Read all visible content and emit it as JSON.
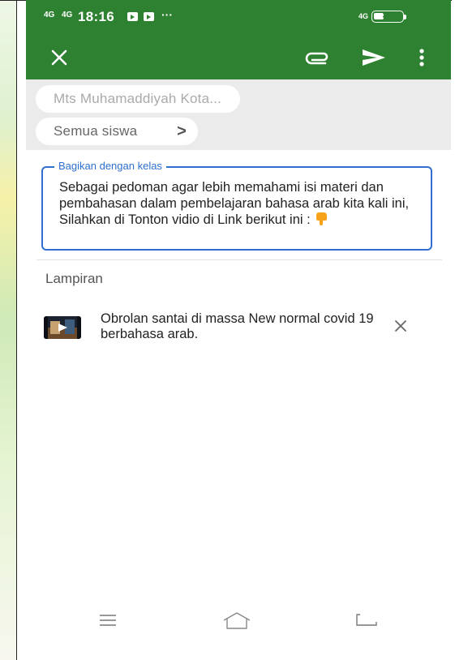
{
  "status_bar": {
    "network1": "4G",
    "network2": "4G",
    "time": "18:16",
    "more": "···",
    "network3": "4G",
    "battery": "37"
  },
  "app_bar": {
    "close_icon": "close-icon",
    "attach_icon": "attach-icon",
    "send_icon": "send-icon",
    "more_icon": "more-vert-icon"
  },
  "audience": {
    "class_name": "Mts Muhamaddiyah Kota...",
    "students": "Semua siswa",
    "students_chevron": ">"
  },
  "composer": {
    "label": "Bagikan dengan kelas",
    "text": "Sebagai pedoman agar lebih memahami isi materi dan pembahasan dalam pembelajaran bahasa arab kita kali ini, Silahkan di Tonton vidio di Link berikut ini : "
  },
  "attachments": {
    "title": "Lampiran",
    "items": [
      {
        "title": "Obrolan santai di massa New normal covid 19 berbahasa arab."
      }
    ]
  },
  "colors": {
    "primary": "#2f8132",
    "field_border": "#2f6fd0",
    "chip_background": "#ebebeb"
  }
}
